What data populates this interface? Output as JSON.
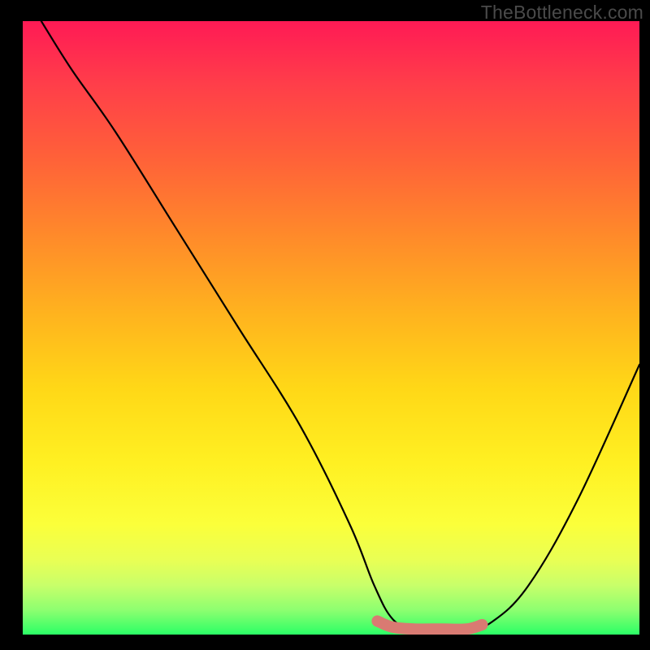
{
  "watermark": "TheBottleneck.com",
  "chart_data": {
    "type": "line",
    "title": "",
    "xlabel": "",
    "ylabel": "",
    "xlim": [
      0,
      100
    ],
    "ylim": [
      0,
      100
    ],
    "series": [
      {
        "name": "bottleneck-curve",
        "x": [
          3,
          8,
          15,
          25,
          35,
          45,
          53,
          57,
          60,
          63.5,
          68,
          72,
          76,
          82,
          90,
          100
        ],
        "y": [
          100,
          92,
          82,
          66,
          50,
          34,
          18,
          8,
          2.5,
          0.8,
          0.8,
          0.8,
          2,
          8,
          22,
          44
        ]
      }
    ],
    "highlight": {
      "name": "flat-minimum",
      "x": [
        57.5,
        60,
        63.5,
        68,
        72,
        74.5
      ],
      "y": [
        2.2,
        1.2,
        0.9,
        0.9,
        0.9,
        1.6
      ]
    },
    "gradient_stops": [
      {
        "pos": 0,
        "color": "#ff1a55"
      },
      {
        "pos": 22,
        "color": "#ff6039"
      },
      {
        "pos": 48,
        "color": "#ffb41e"
      },
      {
        "pos": 72,
        "color": "#fff022"
      },
      {
        "pos": 92,
        "color": "#c8ff6a"
      },
      {
        "pos": 100,
        "color": "#2bff66"
      }
    ]
  }
}
